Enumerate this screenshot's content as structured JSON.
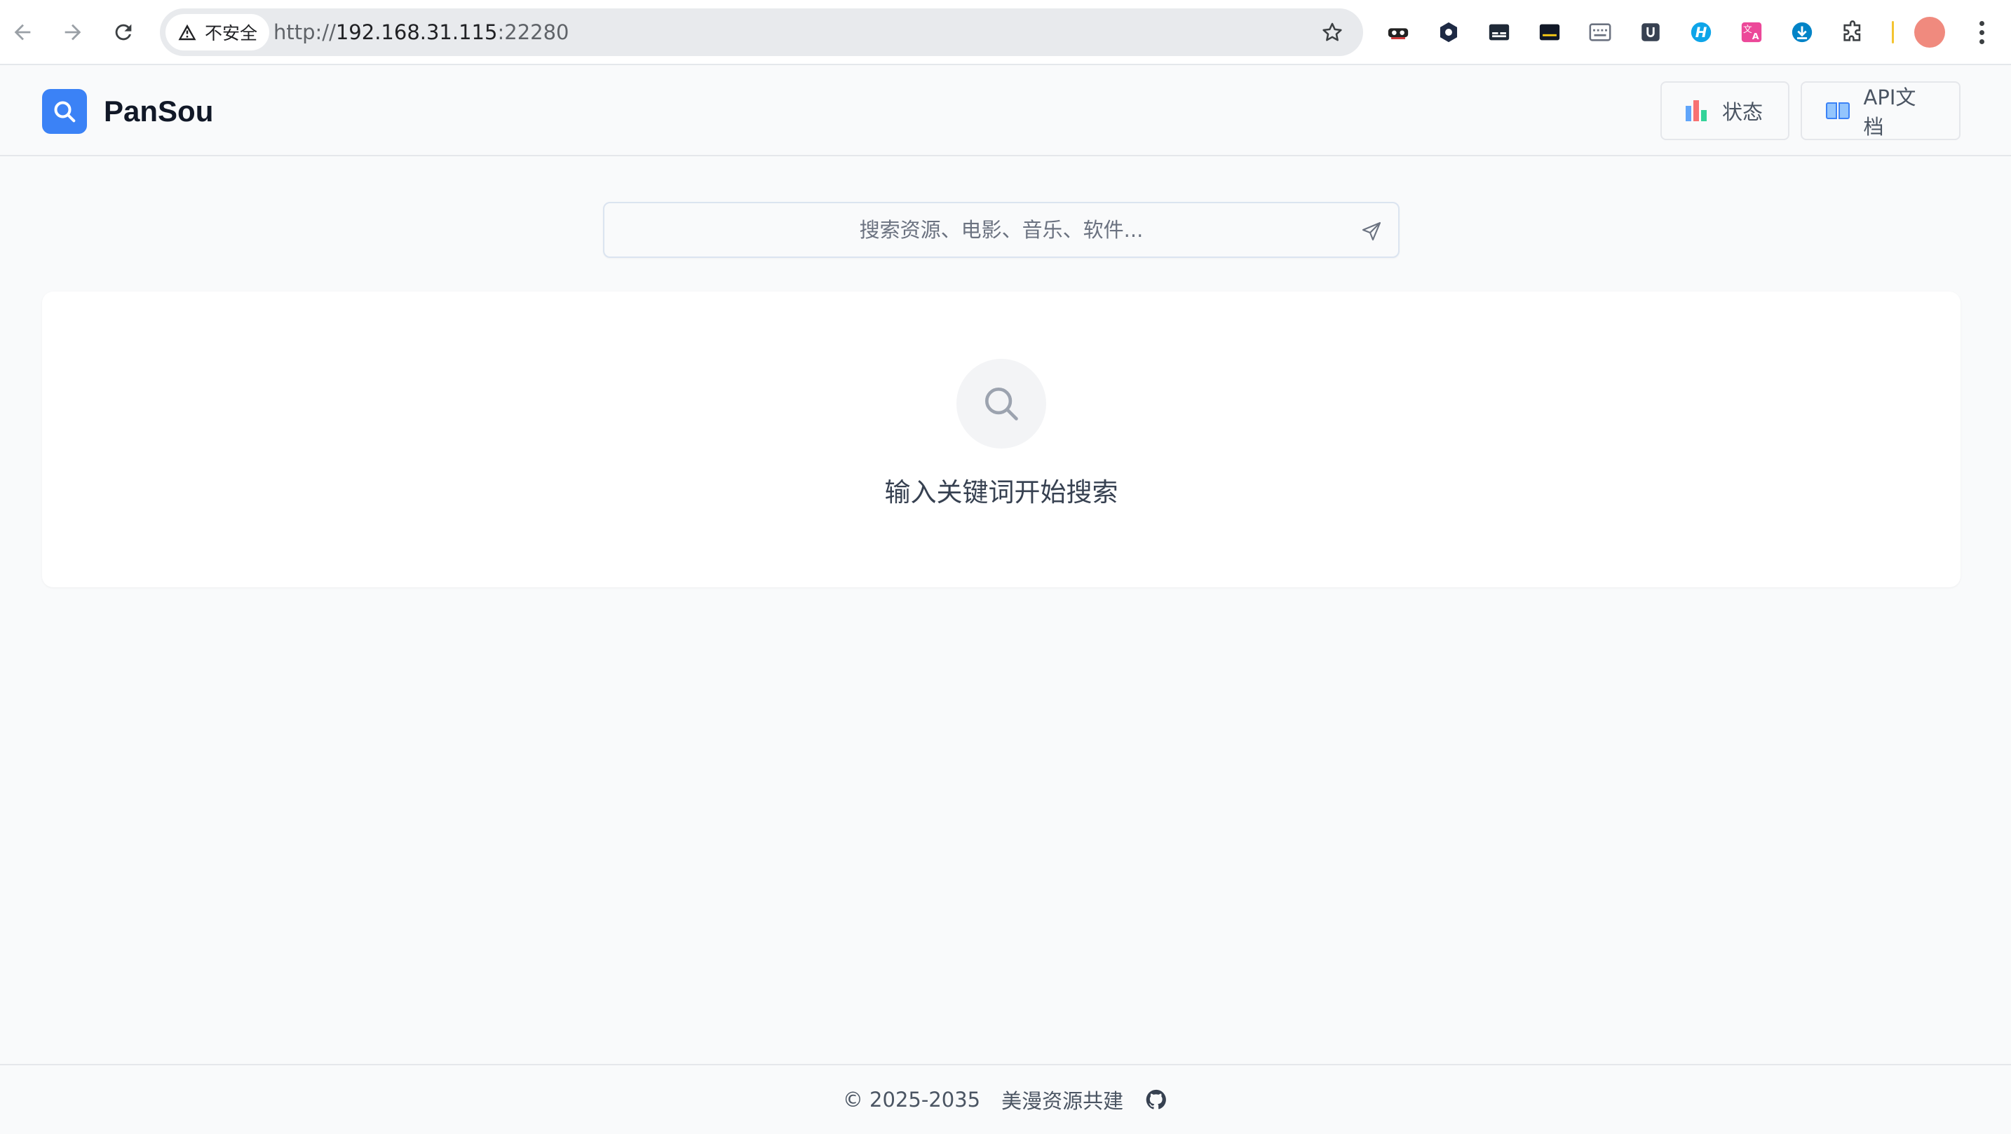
{
  "browser": {
    "security_label": "不安全",
    "url_scheme": "http://",
    "url_host": "192.168.31.115",
    "url_port": ":22280",
    "extensions": [
      "disguise-icon",
      "hexagon-icon",
      "caption-icon",
      "terminal-icon",
      "keyboard-icon",
      "shield-u-icon",
      "h-icon",
      "translate-icon",
      "download-icon",
      "puzzle-icon"
    ]
  },
  "header": {
    "brand": "PanSou",
    "status_label": "状态",
    "api_docs_label": "API文档"
  },
  "search": {
    "placeholder": "搜索资源、电影、音乐、软件..."
  },
  "empty_state": {
    "message": "输入关键词开始搜索"
  },
  "footer": {
    "copyright": "© 2025-2035",
    "link_label": "美漫资源共建"
  },
  "colors": {
    "accent": "#3b82f6",
    "background": "#f9fafb",
    "card": "#ffffff"
  }
}
